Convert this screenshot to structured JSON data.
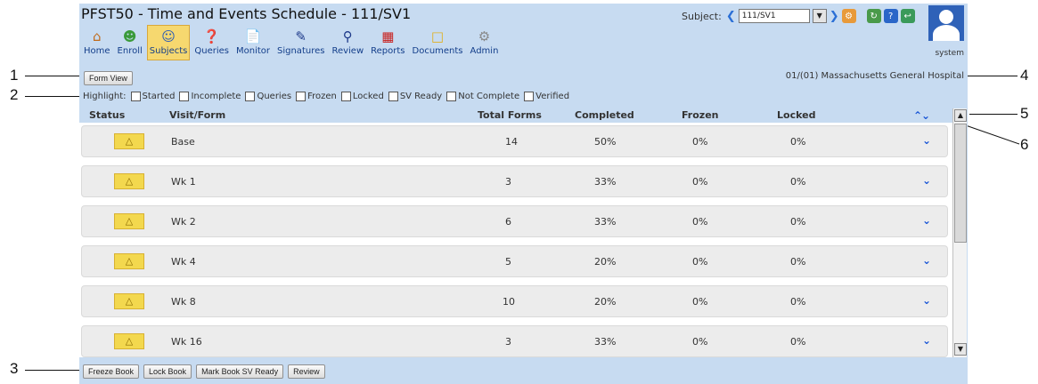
{
  "window": {
    "title": "PFST50 - Time and Events Schedule - 111/SV1",
    "subject_label": "Subject:",
    "subject_value": "111/SV1",
    "user": "system"
  },
  "nav": [
    {
      "label": "Home",
      "icon": "home-icon"
    },
    {
      "label": "Enroll",
      "icon": "enroll-icon"
    },
    {
      "label": "Subjects",
      "icon": "subjects-icon",
      "active": true
    },
    {
      "label": "Queries",
      "icon": "queries-icon"
    },
    {
      "label": "Monitor",
      "icon": "monitor-icon"
    },
    {
      "label": "Signatures",
      "icon": "signatures-icon"
    },
    {
      "label": "Review",
      "icon": "review-icon"
    },
    {
      "label": "Reports",
      "icon": "reports-icon"
    },
    {
      "label": "Documents",
      "icon": "documents-icon"
    },
    {
      "label": "Admin",
      "icon": "admin-icon"
    }
  ],
  "form_view_label": "Form View",
  "site": "01/(01) Massachusetts General Hospital",
  "highlight": {
    "label": "Highlight:",
    "options": [
      "Started",
      "Incomplete",
      "Queries",
      "Frozen",
      "Locked",
      "SV Ready",
      "Not Complete",
      "Verified"
    ]
  },
  "table": {
    "columns": [
      "Status",
      "Visit/Form",
      "Total Forms",
      "Completed",
      "Frozen",
      "Locked"
    ],
    "rows": [
      {
        "visit": "Base",
        "total": "14",
        "completed": "50%",
        "frozen": "0%",
        "locked": "0%"
      },
      {
        "visit": "Wk 1",
        "total": "3",
        "completed": "33%",
        "frozen": "0%",
        "locked": "0%"
      },
      {
        "visit": "Wk 2",
        "total": "6",
        "completed": "33%",
        "frozen": "0%",
        "locked": "0%"
      },
      {
        "visit": "Wk 4",
        "total": "5",
        "completed": "20%",
        "frozen": "0%",
        "locked": "0%"
      },
      {
        "visit": "Wk 8",
        "total": "10",
        "completed": "20%",
        "frozen": "0%",
        "locked": "0%"
      },
      {
        "visit": "Wk 16",
        "total": "3",
        "completed": "33%",
        "frozen": "0%",
        "locked": "0%"
      }
    ]
  },
  "footer_buttons": [
    "Freeze Book",
    "Lock Book",
    "Mark Book SV Ready",
    "Review"
  ],
  "callouts": [
    "1",
    "2",
    "3",
    "4",
    "5",
    "6"
  ],
  "colors": {
    "accent": "#1a56d6",
    "status_warning": "#f3d84e",
    "panel": "#c7dbf1"
  }
}
